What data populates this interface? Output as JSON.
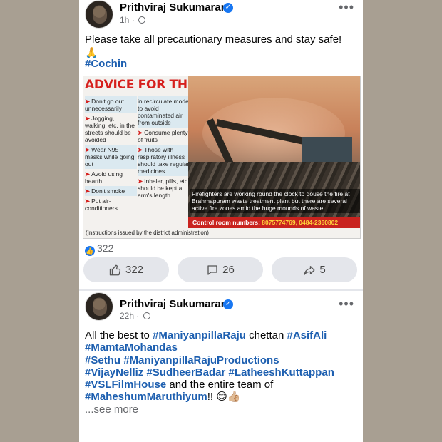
{
  "post1": {
    "author": "Prithviraj Sukumaran",
    "time": "1h",
    "text": "Please take all precautionary measures and stay safe! 🙏",
    "hashtag": "#Cochin",
    "news": {
      "title": "ADVICE FOR THE PUBLIC",
      "col_a": [
        "Don't go out unnecessarily",
        "Jogging, walking, etc. in the streets should be avoided",
        "Wear N95 masks while going out",
        "Avoid using hearth",
        "Don't smoke",
        "Put air-conditioners"
      ],
      "col_b": [
        "in recirculate mode to avoid contaminated air from outside",
        "Consume plenty of fruits",
        "Those with respiratory illness should take regular medicines",
        "Inhaler, pills, etc. should be kept at arm's length"
      ],
      "caption": "Firefighters are working round the clock to douse the fire at Brahmapuram waste treatment plant but there are several active fire zones amid the huge mounds of waste",
      "control_label": "Control room numbers:",
      "control_numbers": "8075774769, 0484-2360802",
      "footnote": "(Instructions issued by the district administration)"
    },
    "reaction_count": "322",
    "actions": {
      "likes": "322",
      "comments": "26",
      "shares": "5"
    }
  },
  "post2": {
    "author": "Prithviraj Sukumaran",
    "time": "22h",
    "text_parts": {
      "p1": "All the best to ",
      "h1": "#ManiyanpillaRaju",
      "p2": " chettan ",
      "h2": "#AsifAli",
      "h3": "#MamtaMohandas",
      "h4": "#Sethu",
      "h5": "#ManiyanpillaRajuProductions",
      "h6": "#VijayNelliz",
      "h7": "#SudheerBadar",
      "h8": "#LatheeshKuttappan",
      "h9": "#VSLFilmHouse",
      "p3": " and the entire team of",
      "h10": "#MaheshumMaruthiyum",
      "p4": "!! 😊👍🏼"
    },
    "see_more": "...see more"
  },
  "icons": [
    "verified-icon",
    "globe-icon",
    "more-icon",
    "like-icon",
    "comment-icon",
    "share-icon"
  ],
  "colors": {
    "brand": "#1877f2",
    "hashtag": "#1d5fb0",
    "news_red": "#d6201d"
  }
}
